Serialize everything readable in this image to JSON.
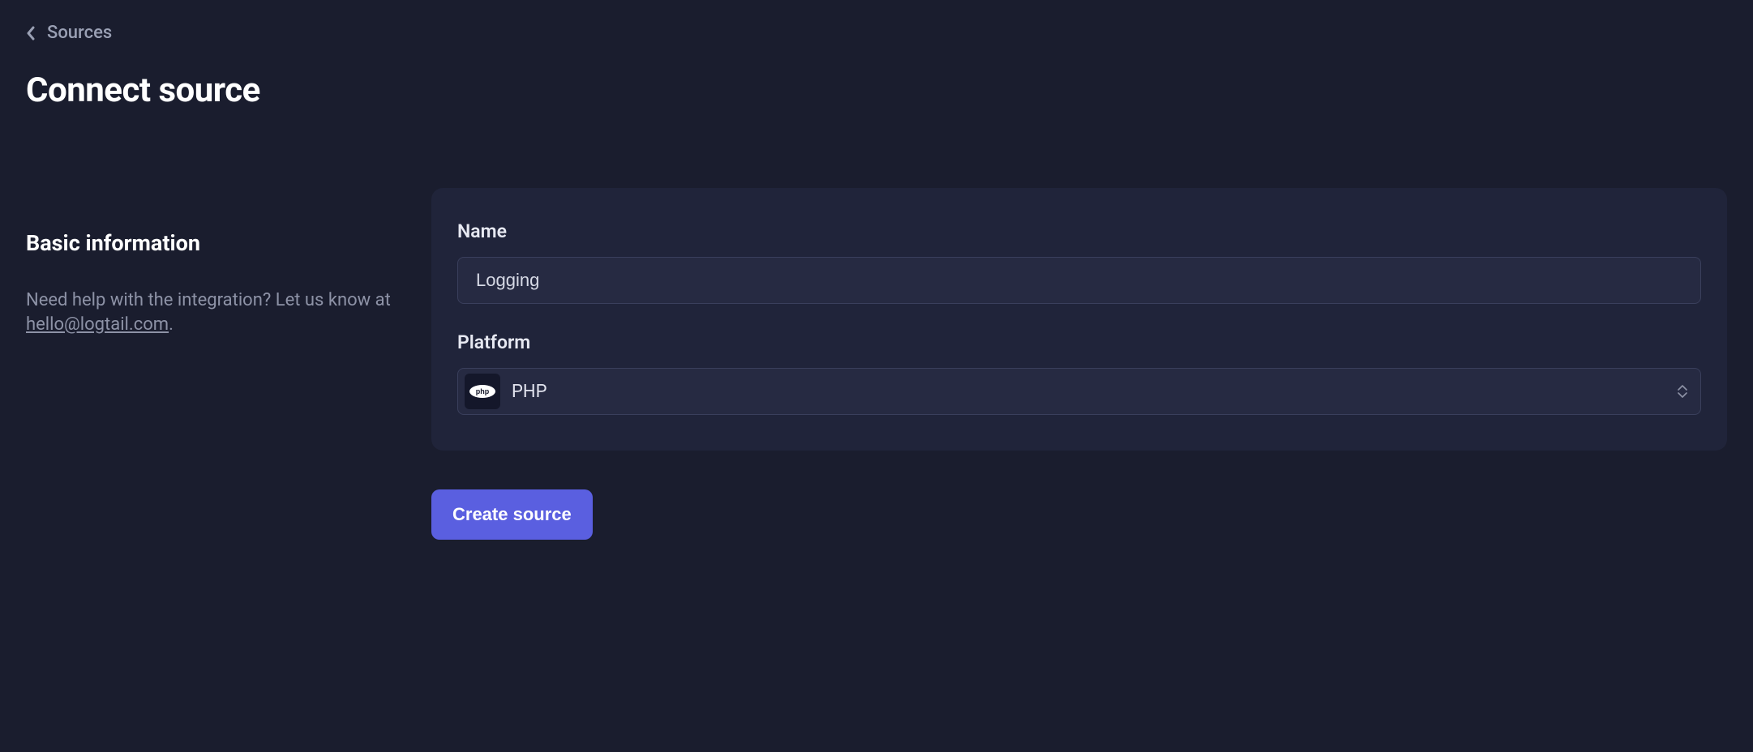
{
  "breadcrumb": {
    "label": "Sources"
  },
  "page": {
    "title": "Connect source"
  },
  "sidebar": {
    "section_heading": "Basic information",
    "help_prefix": "Need help with the integration? Let us know at ",
    "help_email": "hello@logtail.com",
    "help_suffix": "."
  },
  "form": {
    "name_label": "Name",
    "name_value": "Logging",
    "platform_label": "Platform",
    "platform_value": "PHP",
    "platform_icon": "php-icon"
  },
  "actions": {
    "submit_label": "Create source"
  }
}
